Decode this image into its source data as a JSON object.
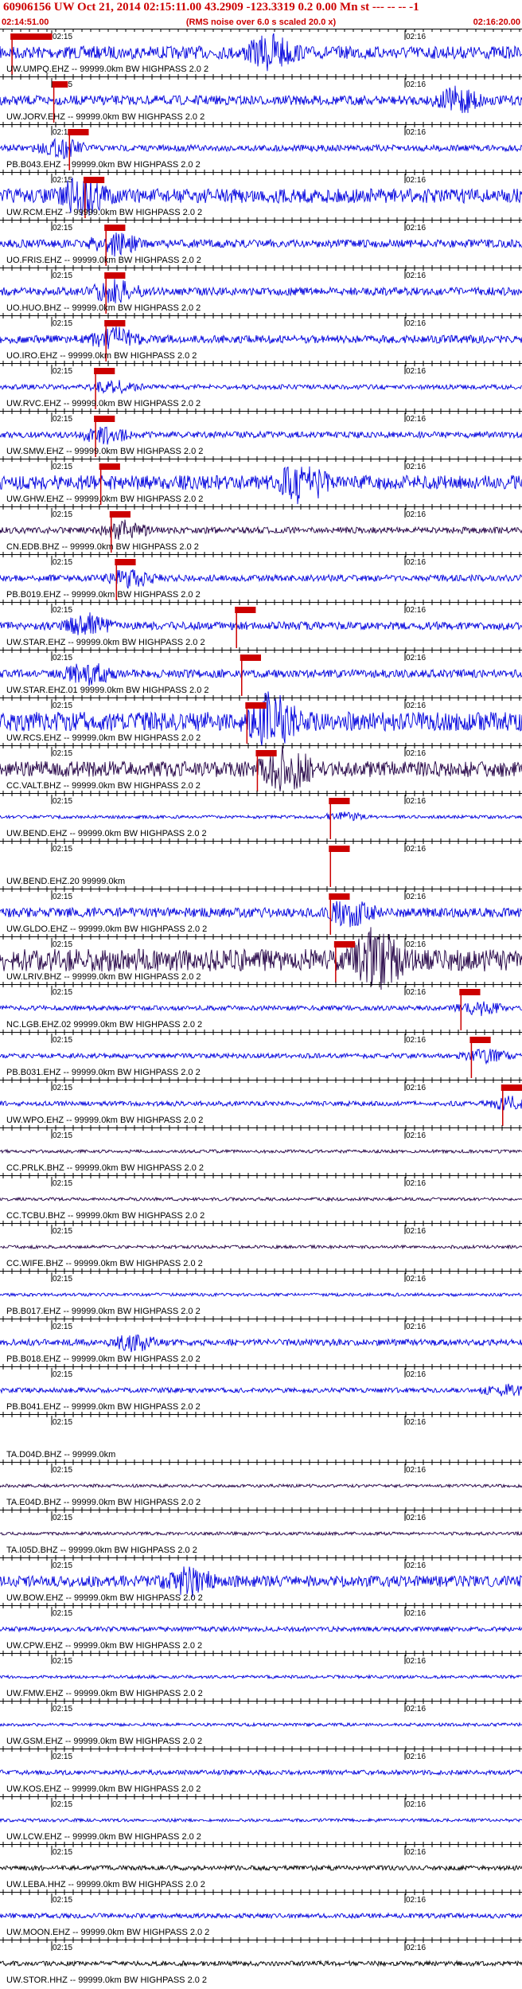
{
  "header": {
    "title": "60906156 UW Oct 21, 2014 02:15:11.00   43.2909 -123.3319  0.2 0.00 Mn st --- -- --  -1",
    "subtitle": "(RMS noise over 6.0 s scaled 20.0 x)",
    "time_start": "02:14:51.00",
    "time_end": "02:16:20.00"
  },
  "colors": {
    "pick": "#cc0000",
    "trace_blue": "#0000dd",
    "trace_dark": "#220044",
    "trace_black": "#000000"
  },
  "tick_labels": {
    "first": "02:15",
    "second": "02:16"
  },
  "stations": [
    {
      "label": "UW.UMPQ.EHZ -- 99999.0km BW  HIGHPASS  2.0  2",
      "color": "blue",
      "amp": 8,
      "burst": 0.52,
      "pick": 0.02,
      "pw": 0.08
    },
    {
      "label": "UW.JORV.EHZ -- 99999.0km BW  HIGHPASS  2.0  2",
      "color": "blue",
      "amp": 6,
      "burst": 0.88,
      "pick": 0.1,
      "pw": 0.03
    },
    {
      "label": "PB.B043.EHZ -- 99999.0km BW  HIGHPASS  2.0  2",
      "color": "blue",
      "amp": 4,
      "burst": 0.12,
      "pick": 0.13,
      "pw": 0.04
    },
    {
      "label": "UW.RCM.EHZ -- 99999.0km BW  HIGHPASS  2.0  2",
      "color": "blue",
      "amp": 9,
      "burst": 0.16,
      "pick": 0.16,
      "pw": 0.04
    },
    {
      "label": "UO.FRIS.EHZ -- 99999.0km BW  HIGHPASS  2.0  2",
      "color": "blue",
      "amp": 5,
      "burst": 0.22,
      "pick": 0.2,
      "pw": 0.04
    },
    {
      "label": "UO.HUO.BHZ -- 99999.0km BW  HIGHPASS  2.0  2",
      "color": "blue",
      "amp": 5,
      "burst": 0.22,
      "pick": 0.2,
      "pw": 0.04
    },
    {
      "label": "UO.IRO.EHZ -- 99999.0km BW  HIGHPASS  2.0  2",
      "color": "blue",
      "amp": 5,
      "burst": 0.22,
      "pick": 0.2,
      "pw": 0.04
    },
    {
      "label": "UW.RVC.EHZ -- 99999.0km BW  HIGHPASS  2.0  2",
      "color": "blue",
      "amp": 3,
      "burst": 0.22,
      "pick": 0.18,
      "pw": 0.04
    },
    {
      "label": "UW.SMW.EHZ -- 99999.0km BW  HIGHPASS  2.0  2",
      "color": "blue",
      "amp": 4,
      "burst": 0.2,
      "pick": 0.18,
      "pw": 0.04
    },
    {
      "label": "UW.GHW.EHZ -- 99999.0km BW  HIGHPASS  2.0  2",
      "color": "blue",
      "amp": 9,
      "burst": 0.58,
      "pick": 0.19,
      "pw": 0.04
    },
    {
      "label": "CN.EDB.BHZ -- 99999.0km BW  HIGHPASS  2.0  2",
      "color": "dark",
      "amp": 4,
      "burst": 0.24,
      "pick": 0.21,
      "pw": 0.04
    },
    {
      "label": "PB.B019.EHZ -- 99999.0km BW  HIGHPASS  2.0  2",
      "color": "blue",
      "amp": 4,
      "burst": 0.25,
      "pick": 0.22,
      "pw": 0.04
    },
    {
      "label": "UW.STAR.EHZ -- 99999.0km BW  HIGHPASS  2.0  2",
      "color": "blue",
      "amp": 5,
      "burst": 0.17,
      "pick": 0.45,
      "pw": 0.04
    },
    {
      "label": "UW.STAR.EHZ.01 99999.0km BW  HIGHPASS  2.0  2",
      "color": "blue",
      "amp": 5,
      "burst": 0.17,
      "pick": 0.46,
      "pw": 0.04
    },
    {
      "label": "UW.RCS.EHZ -- 99999.0km BW  HIGHPASS  2.0  2",
      "color": "blue",
      "amp": 12,
      "burst": 0.52,
      "pick": 0.47,
      "pw": 0.04
    },
    {
      "label": "CC.VALT.BHZ -- 99999.0km BW  HIGHPASS  2.0  2",
      "color": "dark",
      "amp": 10,
      "burst": 0.55,
      "pick": 0.49,
      "pw": 0.04
    },
    {
      "label": "UW.BEND.EHZ -- 99999.0km BW  HIGHPASS  2.0  2",
      "color": "blue",
      "amp": 2,
      "burst": 0.66,
      "pick": 0.63,
      "pw": 0.04
    },
    {
      "label": "UW.BEND.EHZ.20 99999.0km",
      "color": "blue",
      "amp": 0,
      "burst": -1,
      "pick": 0.63,
      "pw": 0.04
    },
    {
      "label": "UW.GLDO.EHZ -- 99999.0km BW  HIGHPASS  2.0  2",
      "color": "blue",
      "amp": 6,
      "burst": 0.67,
      "pick": 0.63,
      "pw": 0.04
    },
    {
      "label": "UW.LRIV.BHZ -- 99999.0km BW  HIGHPASS  2.0  2",
      "color": "dark",
      "amp": 14,
      "burst": 0.72,
      "pick": 0.64,
      "pw": 0.04
    },
    {
      "label": "NC.LGB.EHZ.02 99999.0km BW  HIGHPASS  2.0  2",
      "color": "blue",
      "amp": 3,
      "burst": 0.92,
      "pick": 0.88,
      "pw": 0.04
    },
    {
      "label": "PB.B031.EHZ -- 99999.0km BW  HIGHPASS  2.0  2",
      "color": "blue",
      "amp": 3,
      "burst": 0.93,
      "pick": 0.9,
      "pw": 0.04
    },
    {
      "label": "UW.WPO.EHZ -- 99999.0km BW  HIGHPASS  2.0  2",
      "color": "blue",
      "amp": 3,
      "burst": 0.98,
      "pick": 0.96,
      "pw": 0.04
    },
    {
      "label": "CC.PRLK.BHZ -- 99999.0km BW  HIGHPASS  2.0  2",
      "color": "dark",
      "amp": 2,
      "burst": -1,
      "pick": -1,
      "pw": 0
    },
    {
      "label": "CC.TCBU.BHZ -- 99999.0km BW  HIGHPASS  2.0  2",
      "color": "dark",
      "amp": 2,
      "burst": -1,
      "pick": -1,
      "pw": 0
    },
    {
      "label": "CC.WIFE.BHZ -- 99999.0km BW  HIGHPASS  2.0  2",
      "color": "dark",
      "amp": 2,
      "burst": -1,
      "pick": -1,
      "pw": 0
    },
    {
      "label": "PB.B017.EHZ -- 99999.0km BW  HIGHPASS  2.0  2",
      "color": "blue",
      "amp": 2,
      "burst": -1,
      "pick": -1,
      "pw": 0
    },
    {
      "label": "PB.B018.EHZ -- 99999.0km BW  HIGHPASS  2.0  2",
      "color": "blue",
      "amp": 4,
      "burst": 0.26,
      "pick": -1,
      "pw": 0
    },
    {
      "label": "PB.B041.EHZ -- 99999.0km BW  HIGHPASS  2.0  2",
      "color": "blue",
      "amp": 3,
      "burst": 0.97,
      "pick": -1,
      "pw": 0
    },
    {
      "label": "TA.D04D.BHZ -- 99999.0km",
      "color": "blue",
      "amp": 0,
      "burst": -1,
      "pick": -1,
      "pw": 0
    },
    {
      "label": "TA.E04D.BHZ -- 99999.0km BW  HIGHPASS  2.0  2",
      "color": "dark",
      "amp": 2,
      "burst": -1,
      "pick": -1,
      "pw": 0
    },
    {
      "label": "TA.I05D.BHZ -- 99999.0km BW  HIGHPASS  2.0  2",
      "color": "dark",
      "amp": 2,
      "burst": -1,
      "pick": -1,
      "pw": 0
    },
    {
      "label": "UW.BOW.EHZ -- 99999.0km BW  HIGHPASS  2.0  2",
      "color": "blue",
      "amp": 7,
      "burst": 0.36,
      "pick": -1,
      "pw": 0
    },
    {
      "label": "UW.CPW.EHZ -- 99999.0km BW  HIGHPASS  2.0  2",
      "color": "blue",
      "amp": 3,
      "burst": -1,
      "pick": -1,
      "pw": 0
    },
    {
      "label": "UW.FMW.EHZ -- 99999.0km BW  HIGHPASS  2.0  2",
      "color": "blue",
      "amp": 2,
      "burst": -1,
      "pick": -1,
      "pw": 0
    },
    {
      "label": "UW.GSM.EHZ -- 99999.0km BW  HIGHPASS  2.0  2",
      "color": "blue",
      "amp": 2,
      "burst": -1,
      "pick": -1,
      "pw": 0
    },
    {
      "label": "UW.KOS.EHZ -- 99999.0km BW  HIGHPASS  2.0  2",
      "color": "blue",
      "amp": 3,
      "burst": -1,
      "pick": -1,
      "pw": 0
    },
    {
      "label": "UW.LCW.EHZ -- 99999.0km BW  HIGHPASS  2.0  2",
      "color": "blue",
      "amp": 2,
      "burst": -1,
      "pick": -1,
      "pw": 0
    },
    {
      "label": "UW.LEBA.HHZ -- 99999.0km BW  HIGHPASS  2.0  2",
      "color": "black",
      "amp": 3,
      "burst": -1,
      "pick": -1,
      "pw": 0
    },
    {
      "label": "UW.MOON.EHZ -- 99999.0km BW  HIGHPASS  2.0  2",
      "color": "blue",
      "amp": 3,
      "burst": -1,
      "pick": -1,
      "pw": 0
    },
    {
      "label": "UW.STOR.HHZ -- 99999.0km BW  HIGHPASS  2.0  2",
      "color": "black",
      "amp": 3,
      "burst": -1,
      "pick": -1,
      "pw": 0
    }
  ]
}
